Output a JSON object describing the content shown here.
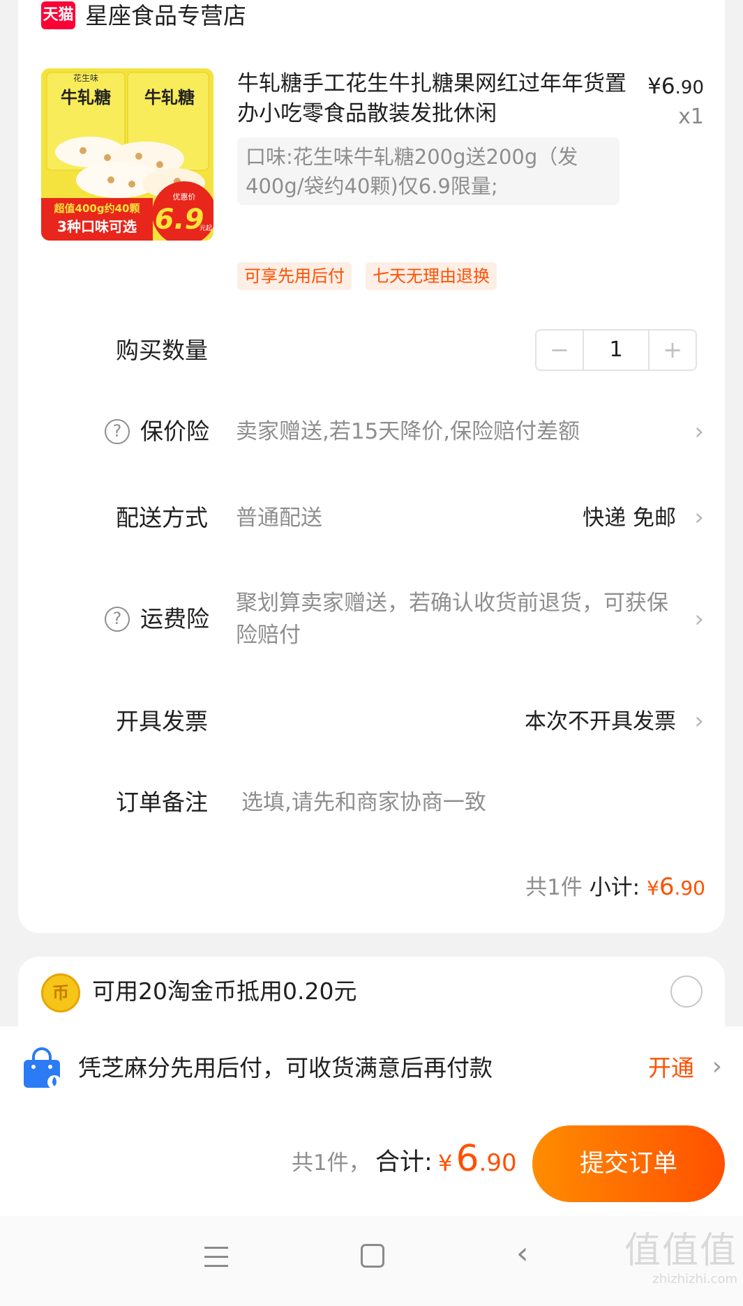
{
  "store": {
    "badge": "天猫",
    "name": "星座食品专营店"
  },
  "product": {
    "image_texts": [
      "花生味",
      "牛轧糖",
      "牛轧糖",
      "超值400g约40颗",
      "3种口味可选",
      "优惠价",
      "6.9",
      "元起"
    ],
    "title": "牛轧糖手工花生牛扎糖果网红过年年货置办小吃零食品散装发批休闲",
    "price_symbol": "¥",
    "price_int": "6",
    "price_cents": ".90",
    "quantity": "x1",
    "spec": "口味:花生味牛轧糖200g送200g（发400g/袋约40颗)仅6.9限量;",
    "tags": [
      "可享先用后付",
      "七天无理由退换"
    ]
  },
  "rows": {
    "quantity_label": "购买数量",
    "quantity_minus": "−",
    "quantity_value": "1",
    "quantity_plus": "+",
    "price_protect_label": "保价险",
    "price_protect_value": "卖家赠送,若15天降价,保险赔付差额",
    "delivery_label": "配送方式",
    "delivery_value": "普通配送",
    "delivery_right": "快递 免邮",
    "shipping_ins_label": "运费险",
    "shipping_ins_value": "聚划算卖家赠送，若确认收货前退货，可获保险赔付",
    "invoice_label": "开具发票",
    "invoice_right": "本次不开具发票",
    "note_label": "订单备注",
    "note_placeholder": "选填,请先和商家协商一致",
    "help_glyph": "?",
    "chevron_glyph": "›"
  },
  "subtotal": {
    "count": "共1件",
    "label": "小计:",
    "yen": "¥",
    "int": "6",
    "cents": ".90"
  },
  "coins": {
    "icon_glyph": "币",
    "text": "可用20淘金币抵用0.20元"
  },
  "credit": {
    "text": "凭芝麻分先用后付，可收货满意后再付款",
    "action": "开通",
    "chevron": "›"
  },
  "checkout": {
    "count": "共1件，",
    "label": "合计:",
    "yen": "¥",
    "int": "6",
    "cents": ".90",
    "submit": "提交订单"
  },
  "navbar": {
    "back_glyph": "‹"
  },
  "watermark": {
    "main": "值值值",
    "sub": "zhizhizhi.com"
  },
  "colors": {
    "accent": "#ff5000",
    "tmall_red": "#ff0036",
    "tag_bg": "#fdeee6",
    "page_bg": "#f2f2f2"
  }
}
